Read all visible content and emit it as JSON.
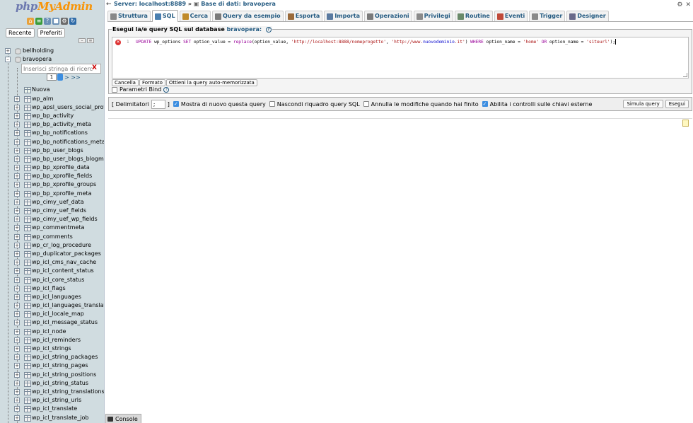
{
  "app": {
    "logo_left": "php",
    "logo_right": "MyAdmin"
  },
  "nav": {
    "icons": [
      "home-icon",
      "logout-icon",
      "docs-icon",
      "sql-docs-icon",
      "settings-icon",
      "reload-icon"
    ],
    "tab_recent": "Recente",
    "tab_favorites": "Preferiti",
    "filter_placeholder": "Inserisci stringa di ricerca",
    "filter_clear": "X",
    "page_value": "1",
    "more": "> >>",
    "databases": [
      {
        "name": "bellholding",
        "expanded": false
      },
      {
        "name": "bravopera",
        "expanded": true
      }
    ],
    "new_label": "Nuova",
    "tables": [
      "wp_alm",
      "wp_apsl_users_social_profile_details",
      "wp_bp_activity",
      "wp_bp_activity_meta",
      "wp_bp_notifications",
      "wp_bp_notifications_meta",
      "wp_bp_user_blogs",
      "wp_bp_user_blogs_blogmeta",
      "wp_bp_xprofile_data",
      "wp_bp_xprofile_fields",
      "wp_bp_xprofile_groups",
      "wp_bp_xprofile_meta",
      "wp_cimy_uef_data",
      "wp_cimy_uef_fields",
      "wp_cimy_uef_wp_fields",
      "wp_commentmeta",
      "wp_comments",
      "wp_cr_log_procedure",
      "wp_duplicator_packages",
      "wp_icl_cms_nav_cache",
      "wp_icl_content_status",
      "wp_icl_core_status",
      "wp_icl_flags",
      "wp_icl_languages",
      "wp_icl_languages_translations",
      "wp_icl_locale_map",
      "wp_icl_message_status",
      "wp_icl_node",
      "wp_icl_reminders",
      "wp_icl_strings",
      "wp_icl_string_packages",
      "wp_icl_string_pages",
      "wp_icl_string_positions",
      "wp_icl_string_status",
      "wp_icl_string_translations",
      "wp_icl_string_urls",
      "wp_icl_translate",
      "wp_icl_translate_job"
    ]
  },
  "breadcrumb": {
    "server": "Server: localhost:8889",
    "sep": "»",
    "database": "Base di dati: bravopera"
  },
  "menu": {
    "tabs": [
      {
        "label": "Struttura",
        "icon": "structure-icon",
        "active": false
      },
      {
        "label": "SQL",
        "icon": "sql-icon",
        "active": true
      },
      {
        "label": "Cerca",
        "icon": "search-icon",
        "active": false
      },
      {
        "label": "Query da esempio",
        "icon": "query-icon",
        "active": false
      },
      {
        "label": "Esporta",
        "icon": "export-icon",
        "active": false
      },
      {
        "label": "Importa",
        "icon": "import-icon",
        "active": false
      },
      {
        "label": "Operazioni",
        "icon": "operations-icon",
        "active": false
      },
      {
        "label": "Privilegi",
        "icon": "privileges-icon",
        "active": false
      },
      {
        "label": "Routine",
        "icon": "routines-icon",
        "active": false
      },
      {
        "label": "Eventi",
        "icon": "events-icon",
        "active": false
      },
      {
        "label": "Trigger",
        "icon": "triggers-icon",
        "active": false
      },
      {
        "label": "Designer",
        "icon": "designer-icon",
        "active": false
      }
    ]
  },
  "query": {
    "legend_prefix": "Esegui la/e query SQL sul database",
    "legend_db": "bravopera:",
    "line_number": "1",
    "tokens": {
      "k_update": "UPDATE",
      "table": " wp_options ",
      "k_set": "SET",
      "mid1": " option_value = ",
      "f_replace": "replace",
      "mid2": "(option_value, ",
      "s_old": "'http://localhost:8888/nomeprogetto'",
      "mid3": ", ",
      "s_new_a": "'http://www.",
      "s_new_b": "nuovodominio",
      "s_new_c": ".it'",
      "mid4": ") ",
      "k_where": "WHERE",
      "mid5": " option_name = ",
      "s_home": "'home'",
      "mid6": " ",
      "k_or": "OR",
      "mid7": " option_name = ",
      "s_siteurl": "'siteurl'",
      "end": ");"
    },
    "btn_clear": "Cancella",
    "btn_format": "Formato",
    "btn_last_query": "Ottieni la query auto-memorizzata",
    "bind_label": "Parametri Bind"
  },
  "options": {
    "delimiter_label_open": "[ Delimitatori",
    "delimiter_value": ";",
    "delimiter_label_close": "]",
    "show_again": {
      "label": "Mostra di nuovo questa query",
      "checked": true
    },
    "hide_box": {
      "label": "Nascondi riquadro query SQL",
      "checked": false
    },
    "rollback": {
      "label": "Annulla le modifiche quando hai finito",
      "checked": false
    },
    "fk_checks": {
      "label": "Abilita i controlli sulle chiavi esterne",
      "checked": true
    },
    "btn_simulate": "Simula query",
    "btn_go": "Esegui"
  },
  "console": {
    "label": "Console"
  }
}
